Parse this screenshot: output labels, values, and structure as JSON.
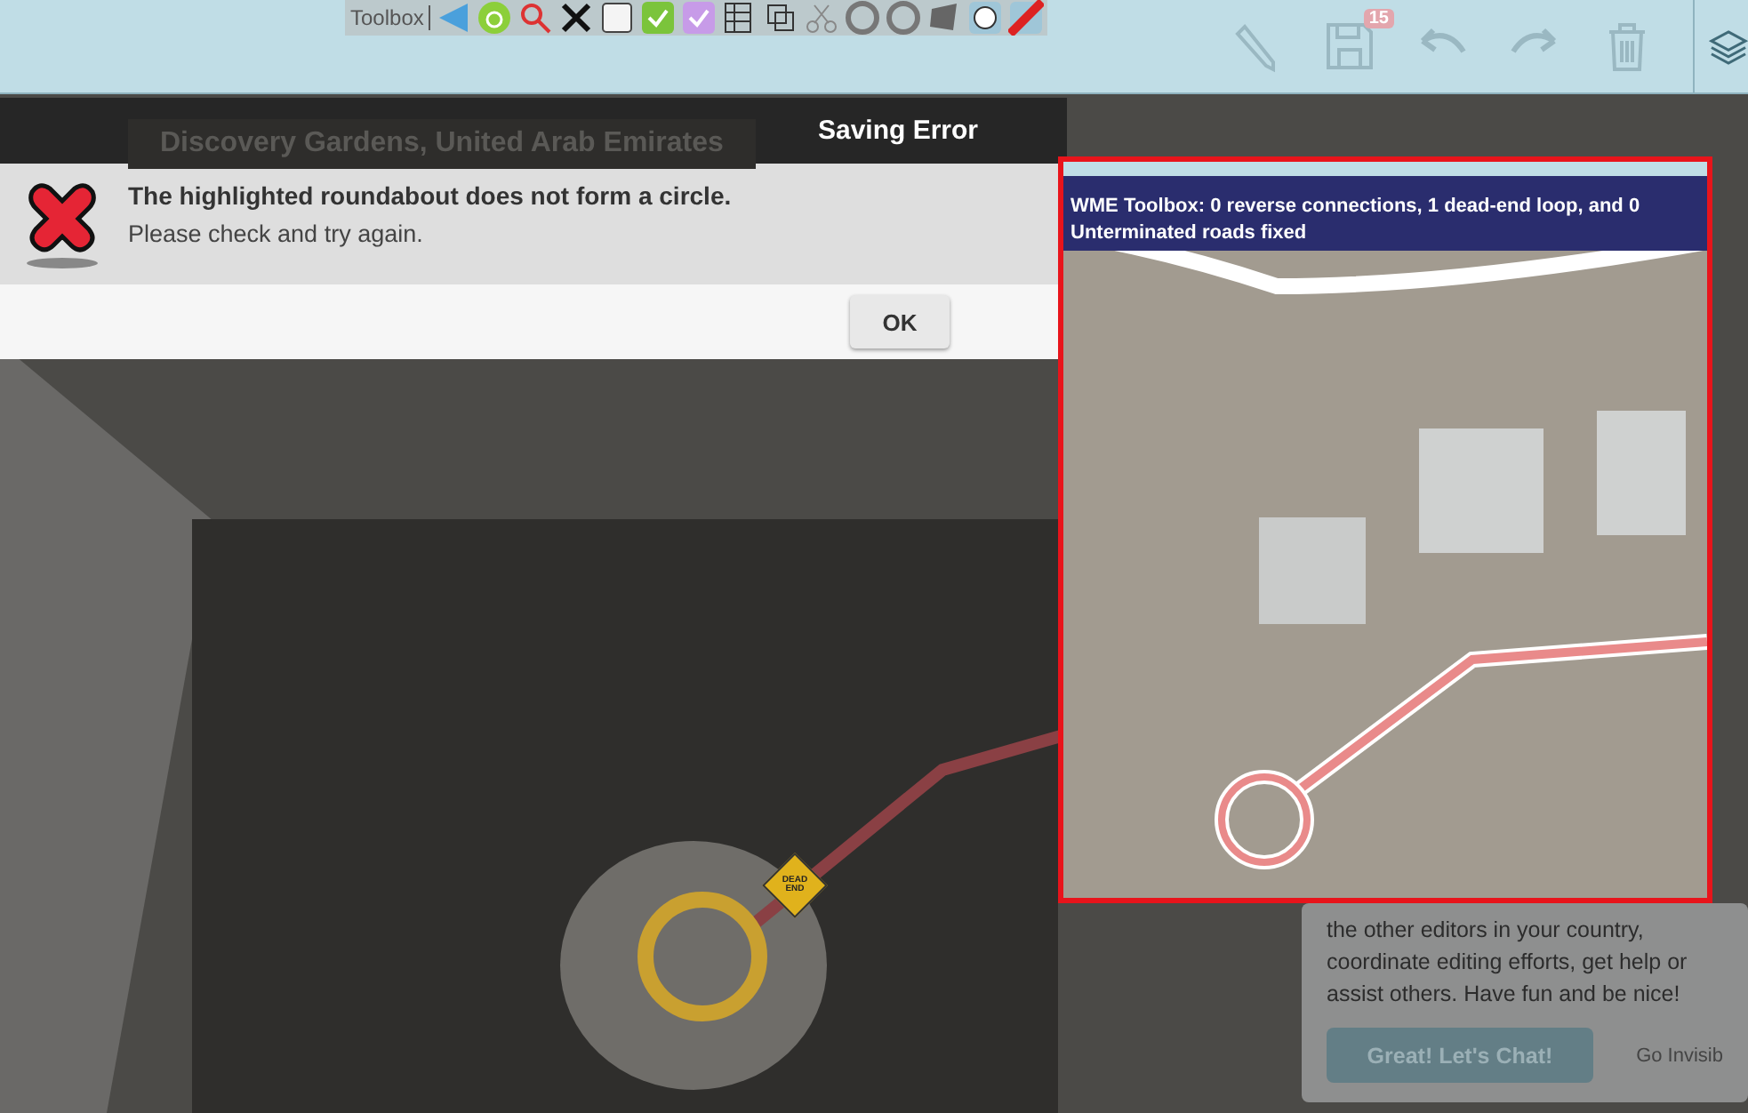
{
  "toolbar": {
    "toolbox_label": "Toolbox",
    "save_count": "15"
  },
  "location": "Discovery Gardens, United Arab Emirates",
  "dialog": {
    "title": "Saving Error",
    "message": "The highlighted roundabout does not form a circle.",
    "detail": "Please check and try again.",
    "button": "OK"
  },
  "map": {
    "sign": "DEAD END"
  },
  "inset": {
    "banner": "WME Toolbox: 0 reverse connections, 1 dead-end loop, and 0 Unterminated roads fixed"
  },
  "chat": {
    "text": "the other editors in your country, coordinate editing efforts, get help or assist others. Have fun and be nice!",
    "button": "Great! Let's Chat!",
    "link": "Go Invisib"
  }
}
